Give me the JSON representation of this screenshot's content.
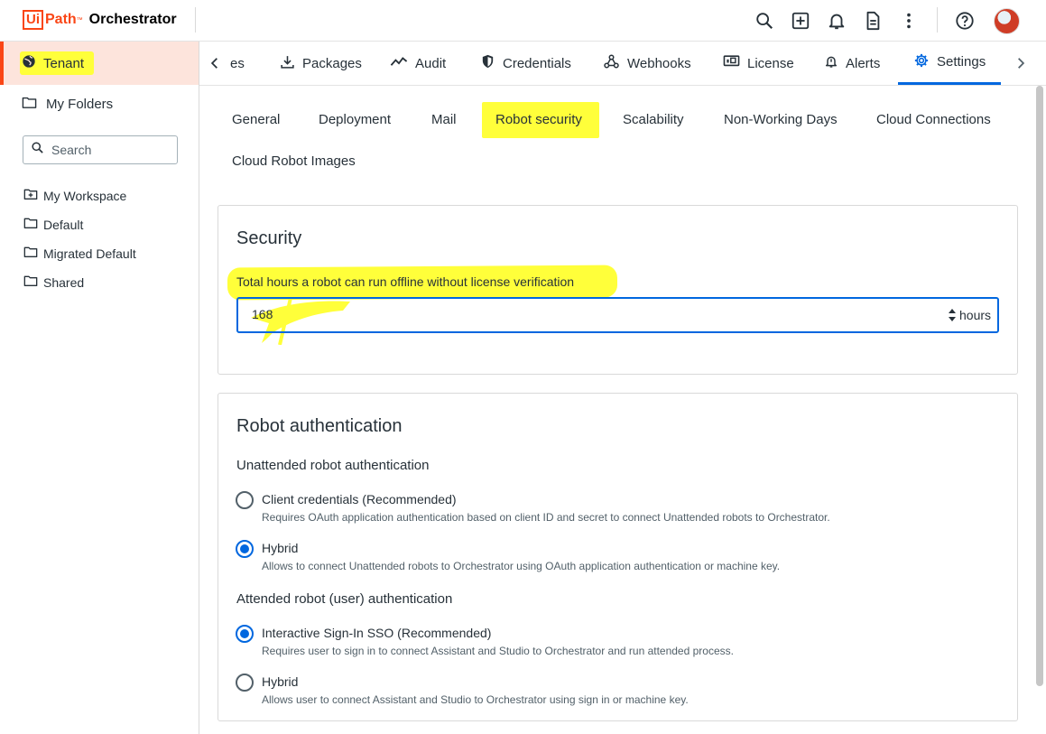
{
  "header": {
    "logo_ui": "Ui",
    "logo_path": "Path",
    "logo_tm": "™",
    "app_name": "Orchestrator",
    "icons": [
      "search-icon",
      "add-icon",
      "bell-icon",
      "document-icon",
      "more-vert-icon",
      "help-icon"
    ]
  },
  "sidebar": {
    "tenant_label": "Tenant",
    "my_folders_label": "My Folders",
    "search_placeholder": "Search",
    "items": [
      {
        "label": "My Workspace",
        "icon": "workspace-folder-icon"
      },
      {
        "label": "Default",
        "icon": "folder-icon"
      },
      {
        "label": "Migrated Default",
        "icon": "folder-icon"
      },
      {
        "label": "Shared",
        "icon": "folder-icon"
      }
    ]
  },
  "tabs": {
    "items": [
      {
        "label": "es",
        "icon": ""
      },
      {
        "label": "Packages",
        "icon": "download-icon"
      },
      {
        "label": "Audit",
        "icon": "trend-icon"
      },
      {
        "label": "Credentials",
        "icon": "shield-icon"
      },
      {
        "label": "Webhooks",
        "icon": "webhook-icon"
      },
      {
        "label": "License",
        "icon": "license-icon"
      },
      {
        "label": "Alerts",
        "icon": "alert-bell-icon"
      },
      {
        "label": "Settings",
        "icon": "gear-icon"
      }
    ],
    "active": "Settings"
  },
  "subtabs": {
    "items": [
      "General",
      "Deployment",
      "Mail",
      "Robot security",
      "Scalability",
      "Non-Working Days",
      "Cloud Connections",
      "Cloud Robot Images"
    ],
    "active": "Robot security"
  },
  "security": {
    "title": "Security",
    "field_label": "Total hours a robot can run offline without license verification",
    "value": "168",
    "unit": "hours"
  },
  "robot_auth": {
    "title": "Robot authentication",
    "unattended": {
      "label": "Unattended robot authentication",
      "options": [
        {
          "label": "Client credentials (Recommended)",
          "desc": "Requires OAuth application authentication based on client ID and secret to connect Unattended robots to Orchestrator.",
          "checked": false
        },
        {
          "label": "Hybrid",
          "desc": "Allows to connect Unattended robots to Orchestrator using OAuth application authentication or machine key.",
          "checked": true
        }
      ]
    },
    "attended": {
      "label": "Attended robot (user) authentication",
      "options": [
        {
          "label": "Interactive Sign-In SSO (Recommended)",
          "desc": "Requires user to sign in to connect Assistant and Studio to Orchestrator and run attended process.",
          "checked": true
        },
        {
          "label": "Hybrid",
          "desc": "Allows user to connect Assistant and Studio to Orchestrator using sign in or machine key.",
          "checked": false
        }
      ]
    }
  }
}
